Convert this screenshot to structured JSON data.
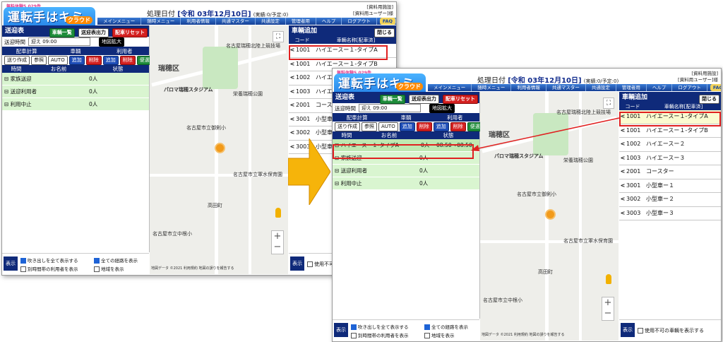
{
  "app": {
    "logo_sub": "無料体験5,029件",
    "logo_main": "運転手はキミだ!!",
    "logo_cloud": "クラウド",
    "date_prefix": "処理日付",
    "date_value": "[令和 03年12月10日]",
    "date_status": "(実績:0/予定:0)",
    "facility": "[資料用施設]",
    "user": "[資料用ユーザー]様",
    "menu": [
      "メインメニュー",
      "随時メニュー",
      "利用者情報",
      "共通マスター",
      "共通設定",
      "管理者用",
      "ヘルプ",
      "ログアウト"
    ],
    "faq": "FAQ"
  },
  "panel": {
    "title": "送迎表",
    "btn_list": "車輌一覧",
    "btn_output": "送迎表出力",
    "btn_reset": "配車リセット",
    "time_label": "送迎時間",
    "time_value": "迎え 09:00",
    "map_expand": "地図拡大",
    "section_headers": [
      "配車計算",
      "車輌",
      "利用者"
    ],
    "btn_send": "送り作成",
    "btn_ref": "参照",
    "btn_auto": "AUTO",
    "btn_add": "追加",
    "btn_del": "削除",
    "btn_add2": "追加",
    "btn_del2": "削除",
    "btn_ride": "便選択",
    "col_time": "時間",
    "col_name": "お名前",
    "col_status": "状態",
    "groups": [
      "家族送迎",
      "送迎利用者",
      "利用中止"
    ],
    "group_counts": [
      "0人",
      "0人",
      "0人"
    ],
    "assigned": {
      "name": "ハイエースー１-タイプA",
      "count": "0人",
      "time": "08:50〜08:50"
    },
    "bottom_label": "表示",
    "check_balloons": "吹き出しを全て表示する",
    "check_routes": "全ての経路を表示",
    "check_other": "別時間帯の利用者を表示",
    "check_area": "地域を表示"
  },
  "map": {
    "labels": [
      "瑞穂区",
      "パロマ瑞穂スタジアム",
      "瑞穂運動場東",
      "名古屋市立桜山中",
      "名古屋瑞穂北陸上競技場",
      "わくわく創造アトリエ",
      "瑞穂フレイムーム",
      "栄養瑞穂公園",
      "さくら保育園",
      "名古屋市立御剣小",
      "弥富町",
      "名古屋市立汐路中",
      "高田町",
      "名古屋市立中根小",
      "名古屋市立軍水保育園",
      "名古屋市立鶴田幼稚園",
      "名古屋市立桜田中"
    ],
    "attribution": "地図データ ©2021 利用規約 地図の誤りを報告する"
  },
  "vehicles": {
    "title": "車輌追加",
    "close": "閉じる",
    "col_code": "コード",
    "col_name": "車輌名称[配車済]",
    "rows": [
      {
        "code": "1001",
        "name": "ハイエースー１-タイプA"
      },
      {
        "code": "1001",
        "name": "ハイエースー１-タイプB"
      },
      {
        "code": "1002",
        "name": "ハイエースー２"
      },
      {
        "code": "1003",
        "name": "ハイエースー３"
      },
      {
        "code": "2001",
        "name": "コースター"
      },
      {
        "code": "3001",
        "name": "小型車ー１"
      },
      {
        "code": "3002",
        "name": "小型車ー２"
      },
      {
        "code": "3003",
        "name": "小型車ー３"
      }
    ],
    "unusable": "使用不可の車輌を表示する",
    "unusable_short": "使用不可"
  },
  "colors": {
    "navy": "#0f2a7a",
    "green_row": "#d9f5d0",
    "highlight": "#e02020",
    "arrow": "#f6b40a"
  }
}
